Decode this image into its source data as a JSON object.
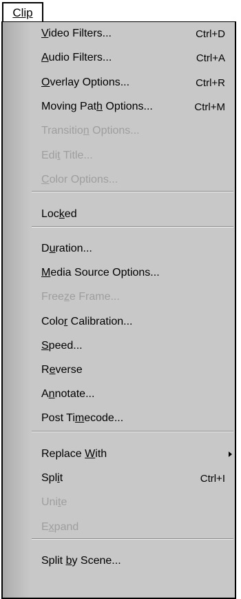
{
  "menu": {
    "title": "Clip"
  },
  "items": [
    {
      "id": "video-filters",
      "pre": "",
      "u": "V",
      "post": "ideo Filters...",
      "shortcut": "Ctrl+D",
      "enabled": true
    },
    {
      "id": "audio-filters",
      "pre": "",
      "u": "A",
      "post": "udio Filters...",
      "shortcut": "Ctrl+A",
      "enabled": true
    },
    {
      "id": "overlay-options",
      "pre": "",
      "u": "O",
      "post": "verlay Options...",
      "shortcut": "Ctrl+R",
      "enabled": true
    },
    {
      "id": "moving-path-options",
      "pre": "Moving Pat",
      "u": "h",
      "post": " Options...",
      "shortcut": "Ctrl+M",
      "enabled": true
    },
    {
      "id": "transition-options",
      "pre": "Transitio",
      "u": "n",
      "post": " Options...",
      "shortcut": "",
      "enabled": false
    },
    {
      "id": "edit-title",
      "pre": "Edi",
      "u": "t",
      "post": " Title...",
      "shortcut": "",
      "enabled": false
    },
    {
      "id": "color-options",
      "pre": "",
      "u": "C",
      "post": "olor Options...",
      "shortcut": "",
      "enabled": false
    },
    {
      "id": "locked",
      "pre": "Loc",
      "u": "k",
      "post": "ed",
      "shortcut": "",
      "enabled": true
    },
    {
      "id": "duration",
      "pre": "D",
      "u": "u",
      "post": "ration...",
      "shortcut": "",
      "enabled": true
    },
    {
      "id": "media-source-options",
      "pre": "",
      "u": "M",
      "post": "edia Source Options...",
      "shortcut": "",
      "enabled": true
    },
    {
      "id": "freeze-frame",
      "pre": "Free",
      "u": "z",
      "post": "e Frame...",
      "shortcut": "",
      "enabled": false
    },
    {
      "id": "color-calibration",
      "pre": "Colo",
      "u": "r",
      "post": " Calibration...",
      "shortcut": "",
      "enabled": true
    },
    {
      "id": "speed",
      "pre": "",
      "u": "S",
      "post": "peed...",
      "shortcut": "",
      "enabled": true
    },
    {
      "id": "reverse",
      "pre": "R",
      "u": "e",
      "post": "verse",
      "shortcut": "",
      "enabled": true
    },
    {
      "id": "annotate",
      "pre": "A",
      "u": "n",
      "post": "notate...",
      "shortcut": "",
      "enabled": true
    },
    {
      "id": "post-timecode",
      "pre": "Post Ti",
      "u": "m",
      "post": "ecode...",
      "shortcut": "",
      "enabled": true
    },
    {
      "id": "replace-with",
      "pre": "Replace ",
      "u": "W",
      "post": "ith",
      "shortcut": "",
      "enabled": true,
      "submenu": true
    },
    {
      "id": "split",
      "pre": "Spl",
      "u": "i",
      "post": "t",
      "shortcut": "Ctrl+I",
      "enabled": true
    },
    {
      "id": "unite",
      "pre": "Uni",
      "u": "t",
      "post": "e",
      "shortcut": "",
      "enabled": false
    },
    {
      "id": "expand",
      "pre": "E",
      "u": "x",
      "post": "pand",
      "shortcut": "",
      "enabled": false
    },
    {
      "id": "split-by-scene",
      "pre": "Split ",
      "u": "b",
      "post": "y Scene...",
      "shortcut": "",
      "enabled": true
    }
  ]
}
